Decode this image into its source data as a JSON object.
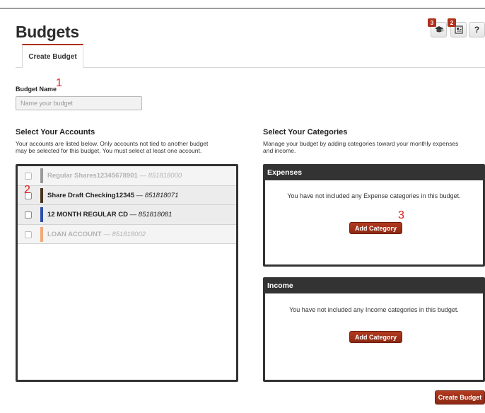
{
  "page": {
    "title": "Budgets"
  },
  "toolbar": {
    "learn_badge": "3",
    "report_badge": "2",
    "help_label": "?"
  },
  "tabs": [
    {
      "label": "Create Budget"
    }
  ],
  "budget_name": {
    "label": "Budget Name",
    "placeholder": "Name your budget",
    "value": ""
  },
  "annotations": {
    "one": "1",
    "two": "2",
    "three": "3"
  },
  "accounts": {
    "title": "Select Your Accounts",
    "description_line1": "Your accounts are listed below. Only accounts not tied to another budget",
    "description_line2": "may be selected for this budget. You must select at least one account.",
    "items": [
      {
        "name": "Regular Shares12345678901",
        "separator": " — ",
        "number": "851818000",
        "color": "#9a9a9a",
        "enabled": false
      },
      {
        "name": "Share Draft Checking12345",
        "separator": " — ",
        "number": "851818071",
        "color": "#4a3420",
        "enabled": true
      },
      {
        "name": "12 MONTH REGULAR CD",
        "separator": " — ",
        "number": "851818081",
        "color": "#2d4fa8",
        "enabled": true
      },
      {
        "name": "LOAN ACCOUNT",
        "separator": " — ",
        "number": "851818002",
        "color": "#f0a878",
        "enabled": false
      }
    ]
  },
  "categories": {
    "title": "Select Your Categories",
    "description_line1": "Manage your budget by adding categories toward your monthly expenses",
    "description_line2": "and income.",
    "expenses": {
      "title": "Expenses",
      "message": "You have not included any Expense categories in this budget.",
      "button": "Add Category"
    },
    "income": {
      "title": "Income",
      "message": "You have not included any Income categories in this budget.",
      "button": "Add Category"
    }
  },
  "footer": {
    "create_button": "Create Budget"
  },
  "colors": {
    "accent": "#b0301b",
    "panel_dark": "#333333"
  }
}
